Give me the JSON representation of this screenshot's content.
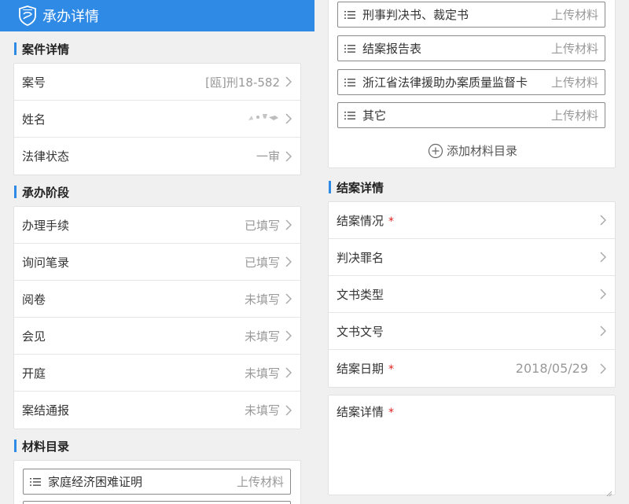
{
  "header": {
    "title": "承办详情"
  },
  "case_section": {
    "title": "案件详情",
    "rows": [
      {
        "label": "案号",
        "value": "[瓯]刑18-582"
      },
      {
        "label": "姓名",
        "value": ""
      },
      {
        "label": "法律状态",
        "value": "一审"
      }
    ]
  },
  "stage_section": {
    "title": "承办阶段",
    "rows": [
      {
        "label": "办理手续",
        "value": "已填写"
      },
      {
        "label": "询问笔录",
        "value": "已填写"
      },
      {
        "label": "阅卷",
        "value": "未填写"
      },
      {
        "label": "会见",
        "value": "未填写"
      },
      {
        "label": "开庭",
        "value": "未填写"
      },
      {
        "label": "案结通报",
        "value": "未填写"
      }
    ]
  },
  "materials_section": {
    "title": "材料目录",
    "upload_label": "上传材料",
    "left_items": [
      {
        "name": "家庭经济困难证明"
      }
    ],
    "right_items": [
      {
        "name": "刑事判决书、裁定书"
      },
      {
        "name": "结案报告表"
      },
      {
        "name": "浙江省法律援助办案质量监督卡"
      },
      {
        "name": "其它"
      }
    ],
    "add_label": "添加材料目录"
  },
  "close_section": {
    "title": "结案详情",
    "rows": [
      {
        "label": "结案情况",
        "required": "*",
        "value": ""
      },
      {
        "label": "判决罪名",
        "required": "",
        "value": ""
      },
      {
        "label": "文书类型",
        "required": "",
        "value": ""
      },
      {
        "label": "文书文号",
        "required": "",
        "value": ""
      },
      {
        "label": "结案日期",
        "required": "*",
        "value": "2018/05/29"
      }
    ],
    "details_label": "结案详情",
    "details_required": "*"
  },
  "colors": {
    "primary": "#2f8ae5",
    "required": "#e02020"
  }
}
